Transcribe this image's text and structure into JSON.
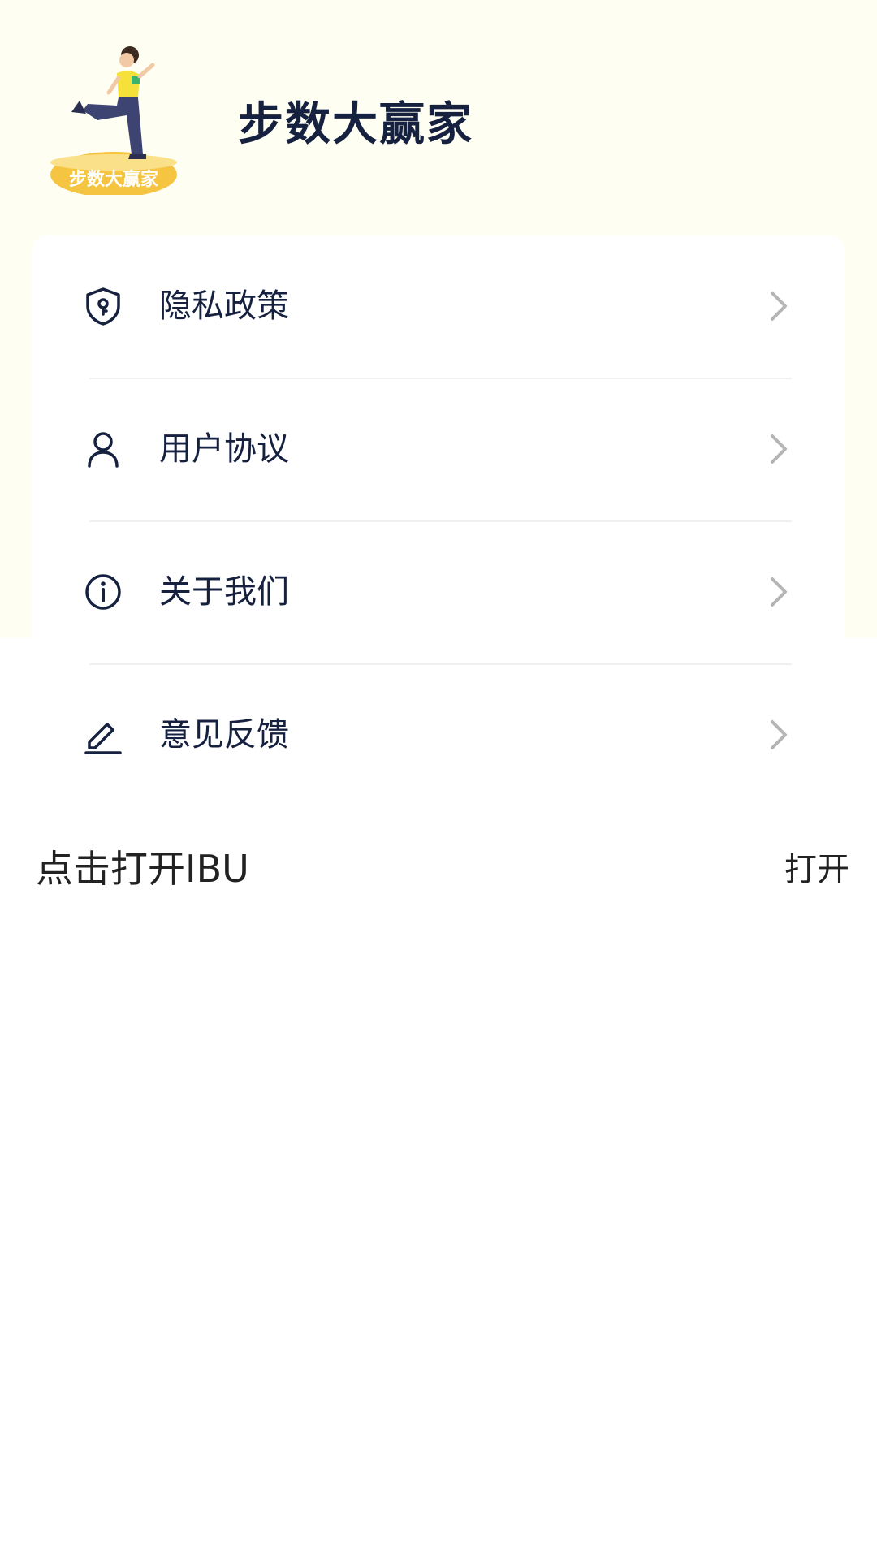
{
  "app": {
    "title": "步数大赢家",
    "logo_text": "步数大赢家",
    "colors": {
      "header_bg": "#fffef2",
      "text_dark": "#15213f",
      "chevron": "#b5b5b5",
      "logo_yellow": "#f5c542"
    }
  },
  "menu": {
    "items": [
      {
        "label": "隐私政策",
        "icon": "shield-key-icon"
      },
      {
        "label": "用户协议",
        "icon": "user-icon"
      },
      {
        "label": "关于我们",
        "icon": "info-icon"
      },
      {
        "label": "意见反馈",
        "icon": "edit-pen-icon"
      }
    ]
  },
  "open_row": {
    "label": "点击打开IBU",
    "action": "打开"
  }
}
